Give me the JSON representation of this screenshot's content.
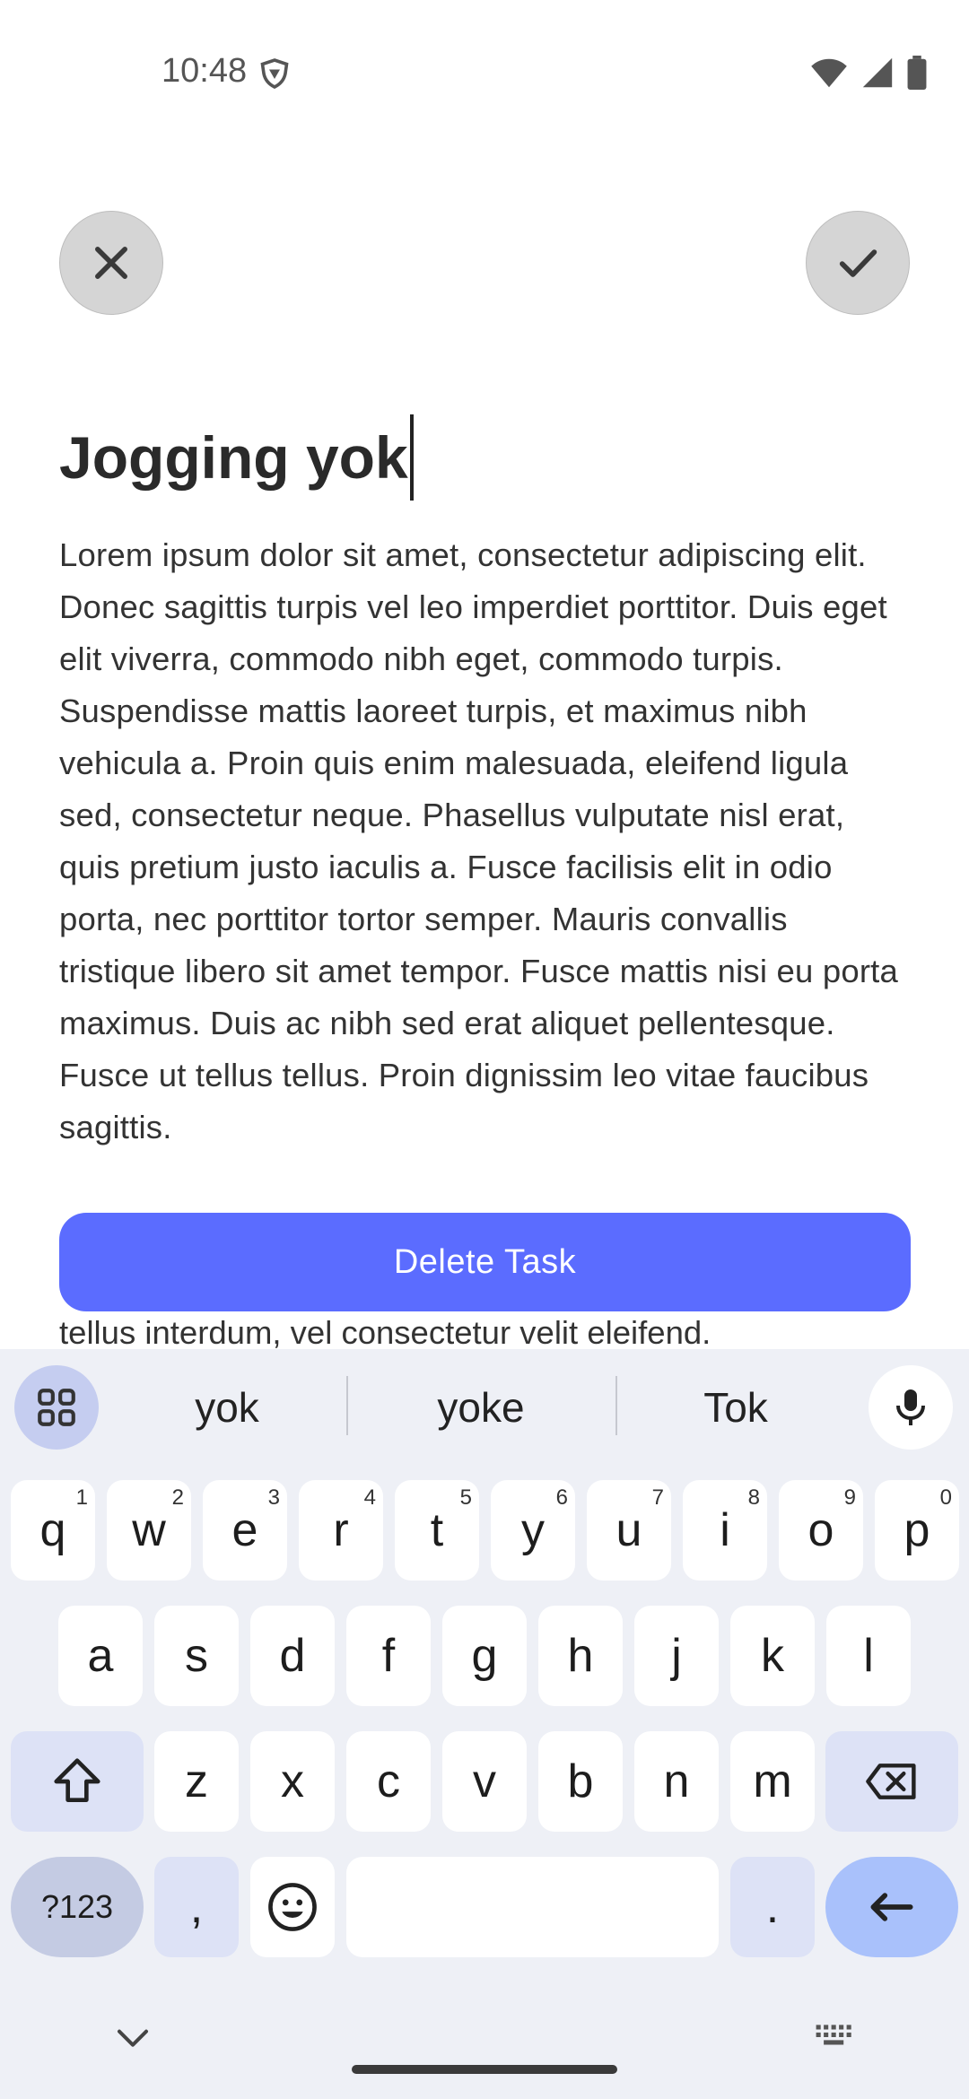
{
  "status_bar": {
    "time": "10:48"
  },
  "task": {
    "title": "Jogging yok",
    "body": "Lorem ipsum dolor sit amet, consectetur adipiscing elit. Donec sagittis turpis vel leo imperdiet porttitor. Duis eget elit viverra, commodo nibh eget, commodo turpis. Suspendisse mattis laoreet turpis, et maximus nibh vehicula a. Proin quis enim malesuada, eleifend ligula sed, consectetur neque. Phasellus vulputate nisl erat, quis pretium justo iaculis a. Fusce facilisis elit in odio porta, nec porttitor tortor semper. Mauris convallis tristique libero sit amet tempor. Fusce mattis nisi eu porta maximus. Duis ac nibh sed erat aliquet pellentesque. Fusce ut tellus tellus. Proin dignissim leo vitae faucibus sagittis.",
    "body_continued": "tellus interdum, vel consectetur velit eleifend.",
    "delete_label": "Delete Task"
  },
  "keyboard": {
    "suggestions": [
      "yok",
      "yoke",
      "Tok"
    ],
    "row1": [
      {
        "key": "q",
        "hint": "1"
      },
      {
        "key": "w",
        "hint": "2"
      },
      {
        "key": "e",
        "hint": "3"
      },
      {
        "key": "r",
        "hint": "4"
      },
      {
        "key": "t",
        "hint": "5"
      },
      {
        "key": "y",
        "hint": "6"
      },
      {
        "key": "u",
        "hint": "7"
      },
      {
        "key": "i",
        "hint": "8"
      },
      {
        "key": "o",
        "hint": "9"
      },
      {
        "key": "p",
        "hint": "0"
      }
    ],
    "row2": [
      "a",
      "s",
      "d",
      "f",
      "g",
      "h",
      "j",
      "k",
      "l"
    ],
    "row3": [
      "z",
      "x",
      "c",
      "v",
      "b",
      "n",
      "m"
    ],
    "symbols_label": "?123",
    "comma_label": ",",
    "period_label": "."
  }
}
